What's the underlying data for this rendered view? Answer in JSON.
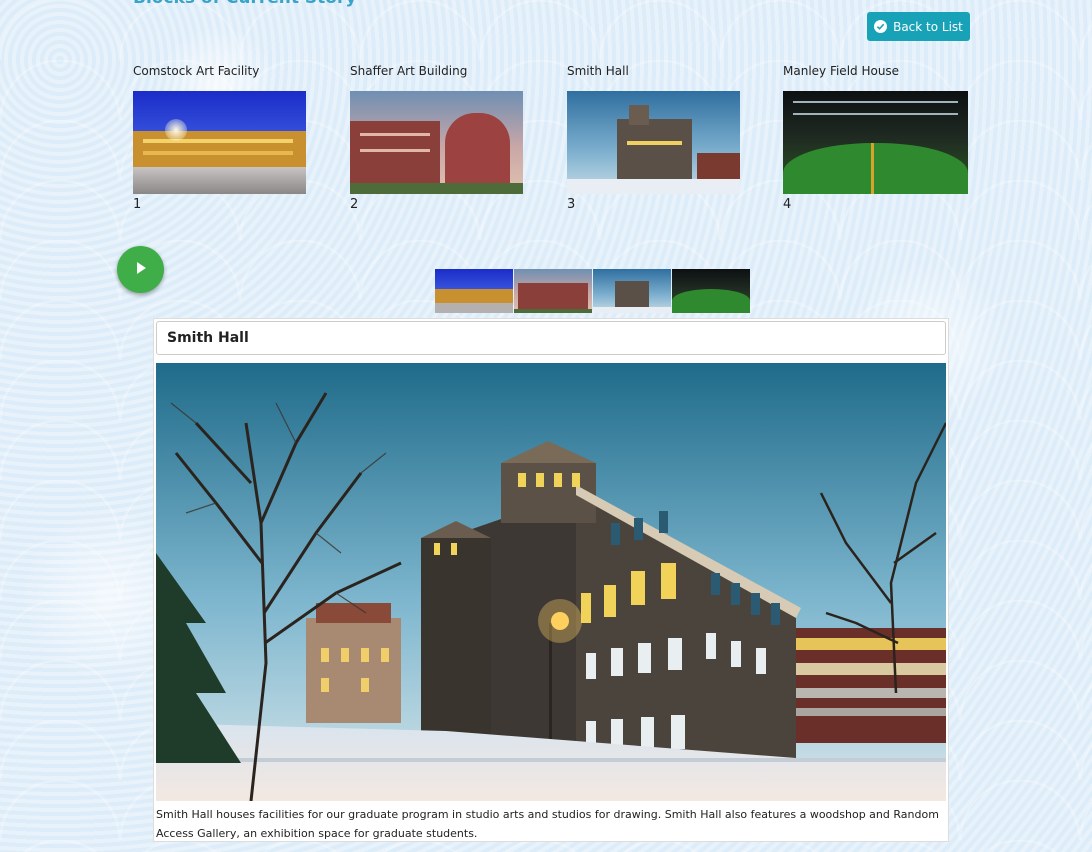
{
  "page": {
    "heading": "Blocks of Current Story",
    "back_label": "Back to List"
  },
  "blocks": [
    {
      "title": "Comstock Art Facility",
      "number": "1"
    },
    {
      "title": "Shaffer Art Building",
      "number": "2"
    },
    {
      "title": "Smith Hall",
      "number": "3"
    },
    {
      "title": "Manley Field House",
      "number": "4"
    }
  ],
  "viewer": {
    "title": "Smith Hall",
    "caption": "Smith Hall houses facilities for our graduate program in studio arts and studios for drawing. Smith Hall also features a woodshop and Random Access Gallery, an exhibition space for graduate students."
  },
  "icons": {
    "back": "check-circle-icon",
    "play": "play-icon"
  },
  "colors": {
    "back_button": "#17a2b8",
    "play_button": "#3fae49",
    "heading": "#3aa3c8"
  }
}
